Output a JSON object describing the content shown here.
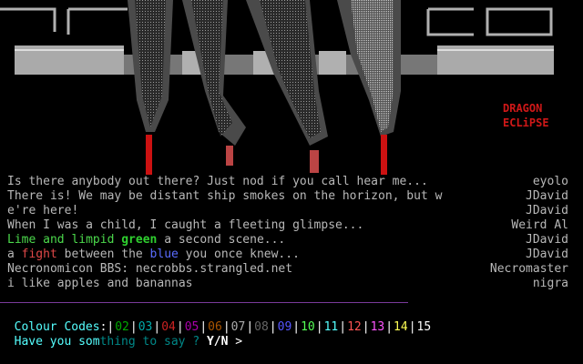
{
  "banner": {
    "brand_line1": "DRAGON",
    "brand_line2": "ECLiPSE"
  },
  "chat": [
    {
      "text": "Is there anybody out there? Just nod if you call hear me...",
      "user": "eyolo"
    },
    {
      "text": "There is! We may be distant ship smokes on the horizon, but w",
      "user": "JDavid"
    },
    {
      "text": "e're here!",
      "user": "JDavid"
    },
    {
      "text": "When I was a child, I caught a fleeting glimpse...",
      "user": "Weird Al"
    },
    {
      "segments": [
        {
          "t": "Lime and limpid ",
          "c": "c-lime"
        },
        {
          "t": "green",
          "c": "c-green"
        },
        {
          "t": " a second scene...",
          "c": ""
        }
      ],
      "user": "JDavid"
    },
    {
      "segments": [
        {
          "t": "a ",
          "c": ""
        },
        {
          "t": "fight",
          "c": "c-red"
        },
        {
          "t": " between the ",
          "c": ""
        },
        {
          "t": "blue",
          "c": "c-blue"
        },
        {
          "t": " you once knew...",
          "c": ""
        }
      ],
      "user": "JDavid"
    },
    {
      "text": "Necronomicon BBS: necrobbs.strangled.net",
      "user": "Necromaster"
    },
    {
      "text": "i like apples and banannas",
      "user": "nigra"
    }
  ],
  "colour_codes": {
    "label": "Colour Codes",
    "codes": [
      {
        "n": "02",
        "color": "#00aa00"
      },
      {
        "n": "03",
        "color": "#00aaaa"
      },
      {
        "n": "04",
        "color": "#cc2222"
      },
      {
        "n": "05",
        "color": "#aa00aa"
      },
      {
        "n": "06",
        "color": "#aa5500"
      },
      {
        "n": "07",
        "color": "#aaaaaa"
      },
      {
        "n": "08",
        "color": "#666666"
      },
      {
        "n": "09",
        "color": "#5555ff"
      },
      {
        "n": "10",
        "color": "#55ff55"
      },
      {
        "n": "11",
        "color": "#55ffff"
      },
      {
        "n": "12",
        "color": "#ff5555"
      },
      {
        "n": "13",
        "color": "#ff55ff"
      },
      {
        "n": "14",
        "color": "#ffff55"
      },
      {
        "n": "15",
        "color": "#ffffff"
      }
    ]
  },
  "prompt": {
    "part1": "Have you som",
    "part2": "thing to say ? ",
    "choice": "Y/N",
    "arrow": " >"
  }
}
